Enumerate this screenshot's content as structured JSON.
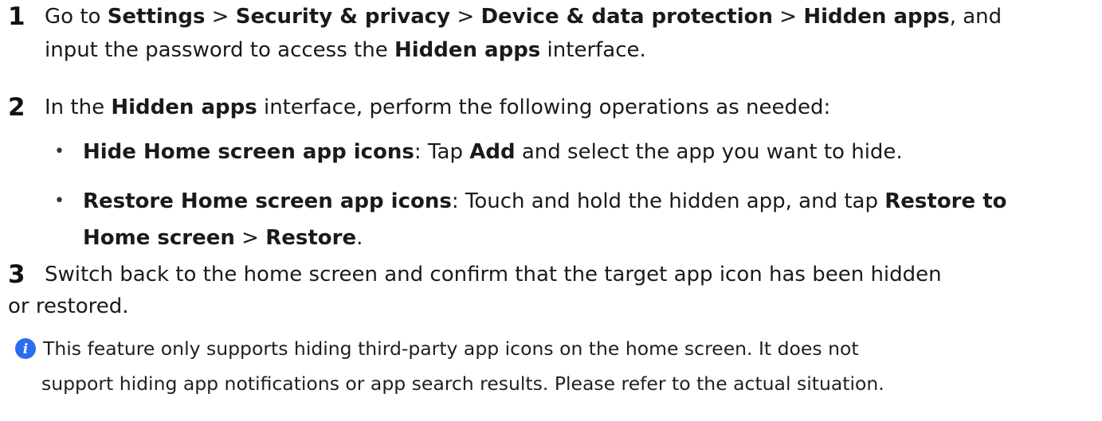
{
  "steps": [
    {
      "number": "1",
      "line1": [
        {
          "t": "Go to ",
          "b": false
        },
        {
          "t": "Settings",
          "b": true
        },
        {
          "t": " > ",
          "b": false
        },
        {
          "t": "Security & privacy",
          "b": true
        },
        {
          "t": " > ",
          "b": false
        },
        {
          "t": "Device & data protection",
          "b": true
        },
        {
          "t": " > ",
          "b": false
        },
        {
          "t": "Hidden apps",
          "b": true
        },
        {
          "t": ", and",
          "b": false
        }
      ],
      "line2": [
        {
          "t": "input the password to access the ",
          "b": false
        },
        {
          "t": "Hidden apps",
          "b": true
        },
        {
          "t": " interface.",
          "b": false
        }
      ]
    },
    {
      "number": "2",
      "line1": [
        {
          "t": "In the ",
          "b": false
        },
        {
          "t": "Hidden apps",
          "b": true
        },
        {
          "t": " interface, perform the following operations as needed:",
          "b": false
        }
      ]
    },
    {
      "number": "3",
      "line1": [
        {
          "t": "Switch back to the home screen and confirm that the target app icon has been hidden",
          "b": false
        }
      ],
      "line2": [
        {
          "t": "or restored.",
          "b": false
        }
      ]
    }
  ],
  "bullets": [
    {
      "dot": "•",
      "line1": [
        {
          "t": "Hide Home screen app icons",
          "b": true
        },
        {
          "t": ": Tap ",
          "b": false
        },
        {
          "t": "Add",
          "b": true
        },
        {
          "t": " and select the app you want to hide.",
          "b": false
        }
      ]
    },
    {
      "dot": "•",
      "line1": [
        {
          "t": "Restore Home screen app icons",
          "b": true
        },
        {
          "t": ": Touch and hold the hidden app, and tap ",
          "b": false
        },
        {
          "t": "Restore to",
          "b": true
        }
      ],
      "line2": [
        {
          "t": "Home screen",
          "b": true
        },
        {
          "t": " > ",
          "b": false
        },
        {
          "t": "Restore",
          "b": true
        },
        {
          "t": ".",
          "b": false
        }
      ]
    }
  ],
  "note": {
    "icon": "info-icon",
    "icon_color": "#2b6cf0",
    "line1": "This feature only supports hiding third-party app icons on the home screen. It does not",
    "line2": "support hiding app notifications or app search results. Please refer to the actual situation."
  }
}
